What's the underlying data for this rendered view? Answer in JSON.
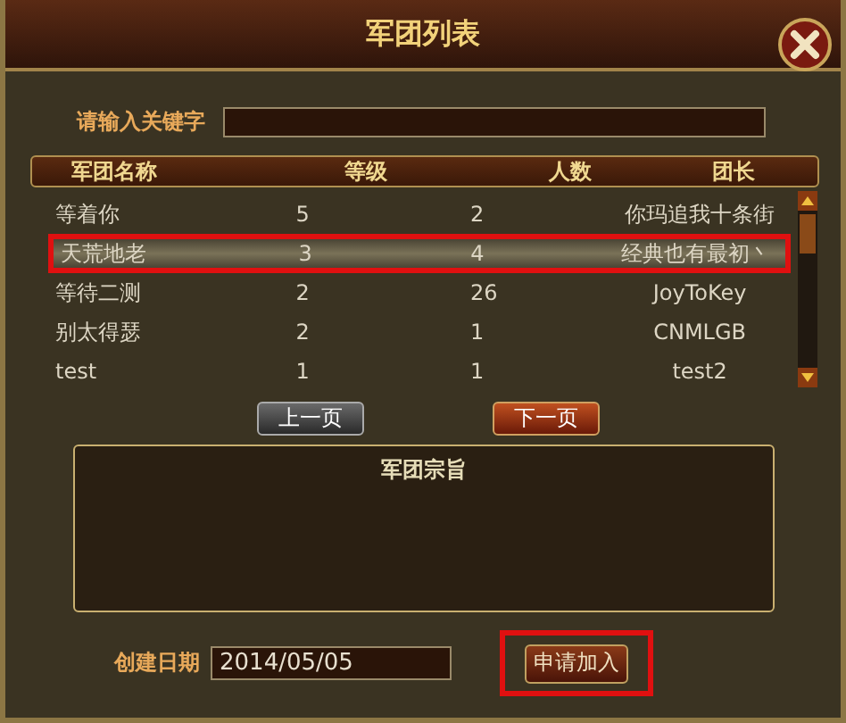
{
  "window": {
    "title": "军团列表"
  },
  "search": {
    "label": "请输入关键字"
  },
  "table": {
    "columns": [
      "军团名称",
      "等级",
      "人数",
      "团长"
    ],
    "rows": [
      {
        "cells": [
          "等着你",
          "5",
          "2",
          "你玛追我十条街"
        ],
        "selected": false
      },
      {
        "cells": [
          "天荒地老",
          "3",
          "4",
          "经典也有最初丶"
        ],
        "selected": true
      },
      {
        "cells": [
          "等待二测",
          "2",
          "26",
          "JoyToKey"
        ],
        "selected": false
      },
      {
        "cells": [
          "别太得瑟",
          "2",
          "1",
          "CNMLGB"
        ],
        "selected": false
      },
      {
        "cells": [
          "test",
          "1",
          "1",
          "test2"
        ],
        "selected": false
      }
    ]
  },
  "pager": [
    {
      "label": "上一页",
      "kind": "grey"
    },
    {
      "label": "下一页",
      "kind": "red"
    }
  ],
  "purpose": {
    "title": "军团宗旨"
  },
  "created": {
    "label": "创建日期",
    "value": "2014/05/05"
  },
  "apply_button": {
    "label": "申请加入",
    "highlighted": true
  }
}
